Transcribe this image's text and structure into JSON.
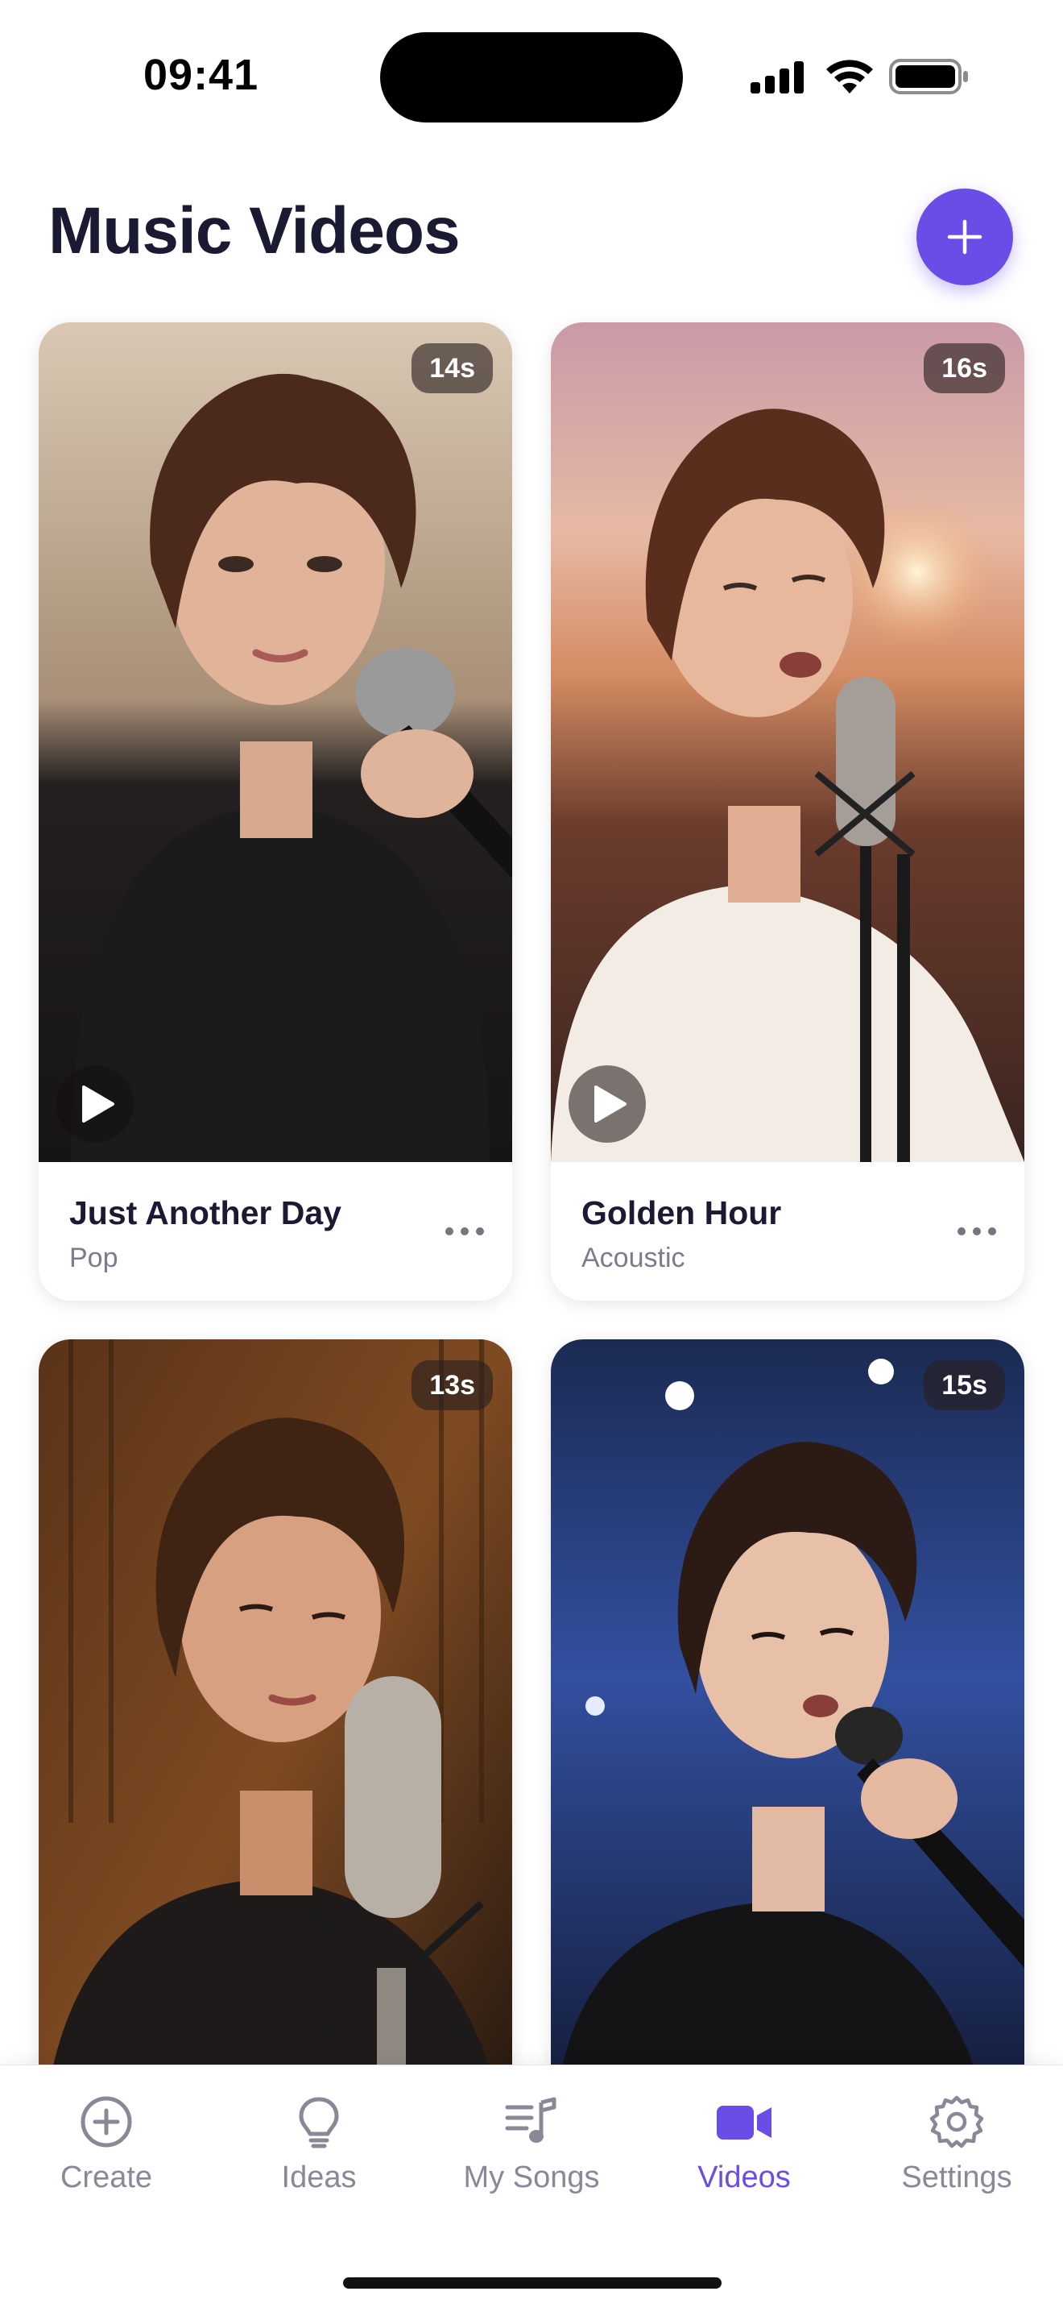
{
  "status_bar": {
    "time": "09:41",
    "icons": [
      "signal-icon",
      "wifi-icon",
      "battery-icon"
    ]
  },
  "header": {
    "title": "Music Videos",
    "add_icon": "plus-icon"
  },
  "videos": [
    {
      "title": "Just Another Day",
      "genre": "Pop",
      "duration": "14s",
      "thumbnail": "singer with handheld microphone, dark shirt, warm indoor light"
    },
    {
      "title": "Golden Hour",
      "genre": "Acoustic",
      "duration": "16s",
      "thumbnail": "singer at studio microphone at sunset, white t-shirt"
    },
    {
      "title": "",
      "genre": "",
      "duration": "13s",
      "thumbnail": "singer at condenser microphone in recording booth"
    },
    {
      "title": "",
      "genre": "",
      "duration": "15s",
      "thumbnail": "singer on stage under blue spotlights"
    }
  ],
  "tab_bar": {
    "tabs": [
      {
        "label": "Create",
        "icon": "plus-circle-icon"
      },
      {
        "label": "Ideas",
        "icon": "lightbulb-icon"
      },
      {
        "label": "My Songs",
        "icon": "music-list-icon"
      },
      {
        "label": "Videos",
        "icon": "video-camera-icon",
        "active": true
      },
      {
        "label": "Settings",
        "icon": "gear-icon"
      }
    ]
  },
  "colors": {
    "accent": "#6a4de6",
    "title": "#1b1a33",
    "secondary": "#7d7b8c",
    "inactive_tab": "#8a8896"
  }
}
